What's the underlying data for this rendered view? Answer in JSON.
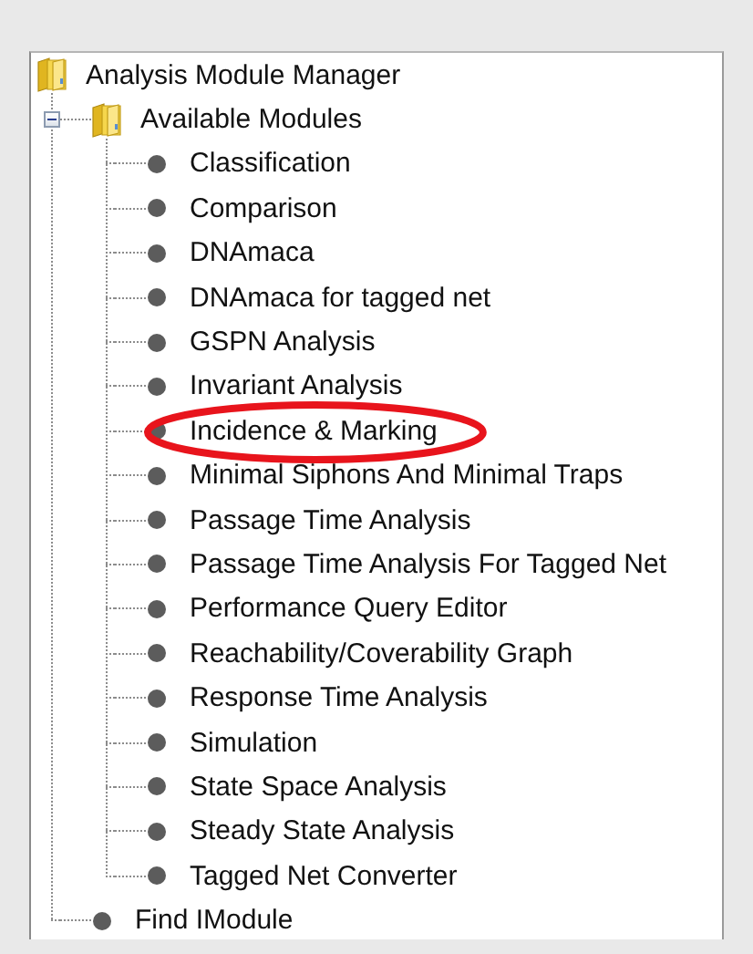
{
  "tree": {
    "items": [
      {
        "label": "Analysis Module Manager",
        "kind": "folder",
        "children": [
          {
            "label": "Available Modules",
            "kind": "folder",
            "expanded": true,
            "children": [
              {
                "label": "Classification",
                "kind": "leaf",
                "highlighted": false
              },
              {
                "label": "Comparison",
                "kind": "leaf",
                "highlighted": false
              },
              {
                "label": "DNAmaca",
                "kind": "leaf",
                "highlighted": false
              },
              {
                "label": "DNAmaca for tagged net",
                "kind": "leaf",
                "highlighted": false
              },
              {
                "label": "GSPN Analysis",
                "kind": "leaf",
                "highlighted": false
              },
              {
                "label": "Invariant Analysis",
                "kind": "leaf",
                "highlighted": false
              },
              {
                "label": "Incidence & Marking",
                "kind": "leaf",
                "highlighted": true
              },
              {
                "label": "Minimal Siphons And Minimal Traps",
                "kind": "leaf",
                "highlighted": false
              },
              {
                "label": "Passage Time Analysis",
                "kind": "leaf",
                "highlighted": false
              },
              {
                "label": "Passage Time Analysis For Tagged Net",
                "kind": "leaf",
                "highlighted": false
              },
              {
                "label": "Performance Query Editor",
                "kind": "leaf",
                "highlighted": false
              },
              {
                "label": "Reachability/Coverability Graph",
                "kind": "leaf",
                "highlighted": false
              },
              {
                "label": "Response Time Analysis",
                "kind": "leaf",
                "highlighted": false
              },
              {
                "label": "Simulation",
                "kind": "leaf",
                "highlighted": false
              },
              {
                "label": "State Space Analysis",
                "kind": "leaf",
                "highlighted": false
              },
              {
                "label": "Steady State Analysis",
                "kind": "leaf",
                "highlighted": false
              },
              {
                "label": "Tagged Net Converter",
                "kind": "leaf",
                "highlighted": false
              }
            ]
          },
          {
            "label": "Find IModule",
            "kind": "leaf",
            "highlighted": false
          }
        ]
      }
    ]
  }
}
